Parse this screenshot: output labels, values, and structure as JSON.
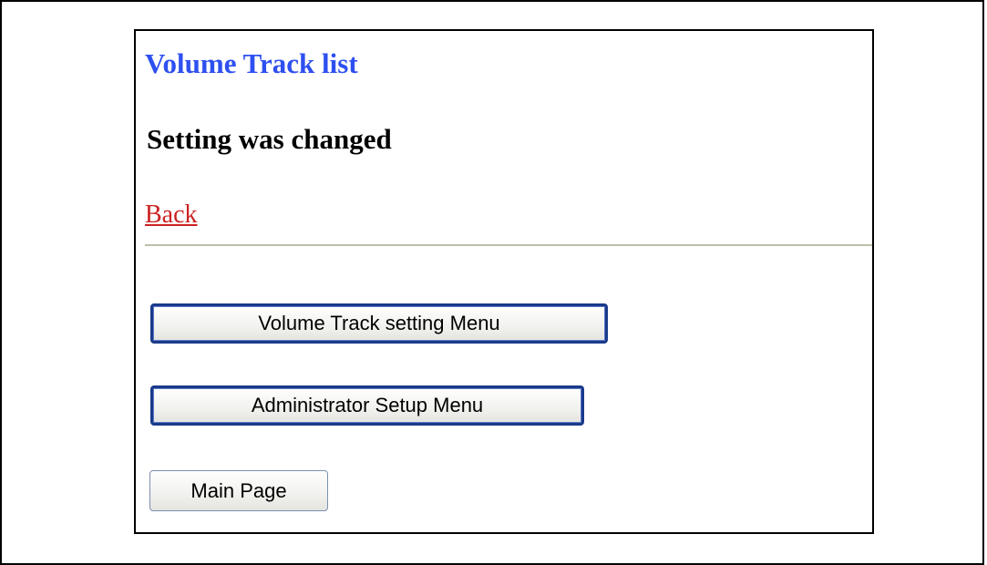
{
  "page": {
    "title": "Volume Track list",
    "status_message": "Setting was changed",
    "back_link": "Back"
  },
  "buttons": {
    "volume_track_setting_menu": "Volume Track setting Menu",
    "administrator_setup_menu": "Administrator Setup Menu",
    "main_page": "Main Page"
  },
  "colors": {
    "title": "#2e50f0",
    "link": "#cc2222",
    "divider": "#b9c2a8",
    "button_border_focused": "#1a3a8a"
  }
}
